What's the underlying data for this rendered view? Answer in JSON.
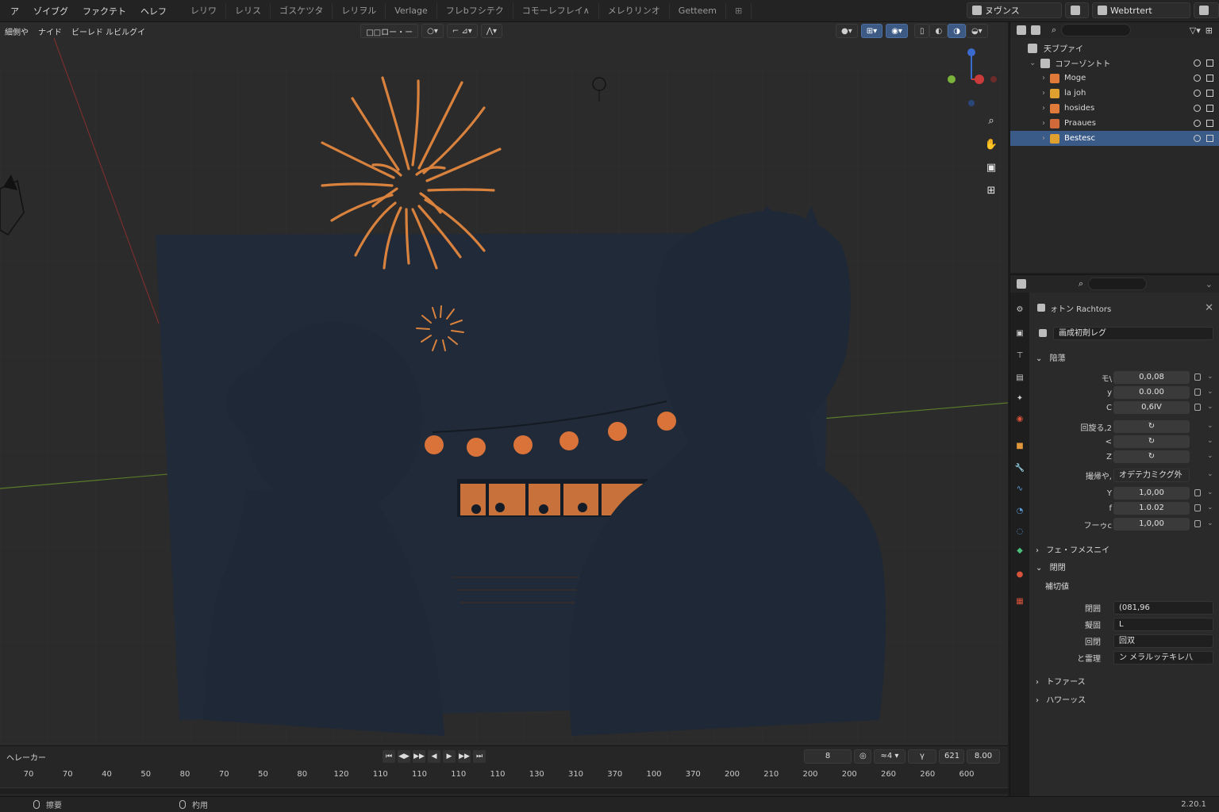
{
  "menu": [
    "ア",
    "ゾイブグ",
    "ファクテト",
    "ヘレフ"
  ],
  "workspaces": [
    "レリワ",
    "レリス",
    "ゴスケツタ",
    "レリヲル",
    "Verlage",
    "フレbフシテク",
    "コモーレフレイ∧",
    "メレりリンオ",
    "Getteem",
    "⊞"
  ],
  "scene": {
    "name": "ヌヴンス",
    "view_layer": "Webtrtert"
  },
  "viewport": {
    "mode_menu": [
      "細側や",
      "ナイド",
      "ビーレド ルビルグイ"
    ],
    "transform_pill": "□□ロー・ー",
    "gizmo_axes": [
      "X",
      "Y",
      "Z"
    ],
    "nav_icons": [
      "zoom-icon",
      "pan-icon",
      "camera-view-icon",
      "perspective-icon"
    ]
  },
  "timeline": {
    "label": "ヘレーカー",
    "frame_numbers": [
      "70",
      "70",
      "40",
      "50",
      "80",
      "70",
      "50",
      "80",
      "120",
      "110",
      "110",
      "110",
      "110",
      "130",
      "310",
      "370",
      "100",
      "370",
      "200",
      "210",
      "200",
      "200",
      "260",
      "260",
      "600"
    ],
    "current_frame": "621",
    "fps": "8.00",
    "start_box": "8",
    "end_box": "≈4 ▾",
    "key_box": "γ"
  },
  "status": {
    "left": "擦要",
    "middle": "杓用",
    "version": "2.20.1"
  },
  "outliner": {
    "title": "天ブプァイ",
    "collection": "コフーゾントト",
    "items": [
      {
        "name": "Moge",
        "color": "#e07a3a",
        "selected": false
      },
      {
        "name": "la joh",
        "color": "#e0a030",
        "selected": false
      },
      {
        "name": "hosides",
        "color": "#e07a3a",
        "selected": false
      },
      {
        "name": "Praaues",
        "color": "#d06a3a",
        "selected": false
      },
      {
        "name": "Bestesc",
        "color": "#e0a030",
        "selected": true
      }
    ]
  },
  "properties": {
    "object_name": "ォトン Rachtors",
    "data_dropdown": "画成初剤レグ",
    "section_transform": "陪蕩",
    "location": {
      "label_x": "モ\\",
      "label_y": "y",
      "label_z": "C",
      "x": "0,0,08",
      "y": "0.0.00",
      "z": "0,6IV"
    },
    "rotation": {
      "label": "回旋る,2",
      "label_y": "<",
      "label_z": "Z",
      "x": "↻",
      "y": "↻",
      "z": "↻"
    },
    "rotation_mode_label": "撮帰や,",
    "rotation_mode": "オデテ力ミクグ外",
    "scale": {
      "label_x": "Y",
      "label_y": "f",
      "label_z": "フーゥc",
      "x": "1,0,00",
      "y": "1.0.02",
      "z": "1,0,00"
    },
    "section_delta": "フェ・フメスニイ",
    "section_relations": "閉閉",
    "relations_sub": "補切値",
    "parent_label": "閉囲",
    "parent_value": "(081,96",
    "parent_type_label": "擬固",
    "parent_type_value": "L",
    "pass_label": "回閉",
    "pass_value": "回双",
    "collection_label": "と雷理",
    "collection_value": "ン メラルッテキレ八",
    "section_coll": "トファース",
    "section_inst": "ハワーッス"
  },
  "colors": {
    "accent": "#3a5a88",
    "firework": "#d9823e",
    "lantern": "#d9733a",
    "silhouette": "#1e2836"
  }
}
